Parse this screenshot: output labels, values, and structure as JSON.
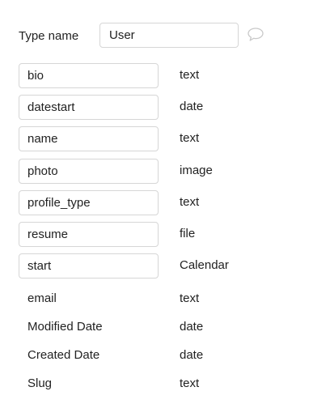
{
  "header": {
    "type_name_label": "Type name",
    "type_name_value": "User",
    "comment_icon": "speech-bubble-icon"
  },
  "fields": [
    {
      "name": "bio",
      "type": "text",
      "editable": true
    },
    {
      "name": "datestart",
      "type": "date",
      "editable": true
    },
    {
      "name": "name",
      "type": "text",
      "editable": true
    },
    {
      "name": "photo",
      "type": "image",
      "editable": true
    },
    {
      "name": "profile_type",
      "type": "text",
      "editable": true
    },
    {
      "name": "resume",
      "type": "file",
      "editable": true
    },
    {
      "name": "start",
      "type": "Calendar",
      "editable": true
    },
    {
      "name": "email",
      "type": "text",
      "editable": false
    },
    {
      "name": "Modified Date",
      "type": "date",
      "editable": false
    },
    {
      "name": "Created Date",
      "type": "date",
      "editable": false
    },
    {
      "name": "Slug",
      "type": "text",
      "editable": false
    }
  ]
}
